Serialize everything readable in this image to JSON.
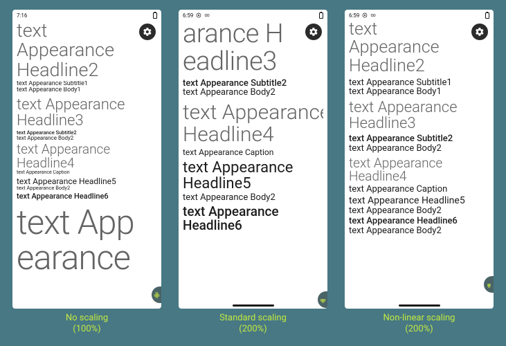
{
  "phones": [
    {
      "status_time": "7:16",
      "lines": {
        "l1": "text",
        "l2": "Appearance",
        "l3": "Headline2",
        "sub1": "text Appearance Subtitle1",
        "body1": "text Appearance Body1",
        "h3a": "text Appearance",
        "h3b": "Headline3",
        "sub2": "text Appearance Subtitle2",
        "body2": "text Appearance Body2",
        "h4a": "text Appearance",
        "h4b": "Headline4",
        "cap": "text Appearance Caption",
        "h5": "text Appearance Headline5",
        "bd2b": "text Appearance Body2",
        "h6": "text Appearance Headline6",
        "big1": "text App",
        "big2": "earance"
      }
    },
    {
      "status_time": "6:59",
      "lines": {
        "h3a": "arance H",
        "h3b": "eadline3",
        "sub2": "text Appearance Subtitle2",
        "body2": "text Appearance Body2",
        "h4a": "text Appearance",
        "h4b": "Headline4",
        "cap": "text Appearance Caption",
        "h5a": "text Appearance",
        "h5b": "Headline5",
        "bd2b": "text Appearance Body2",
        "h6a": "text Appearance",
        "h6b": "Headline6"
      }
    },
    {
      "status_time": "6:59",
      "lines": {
        "l1": "text",
        "l2": "Appearance",
        "l3": "Headline2",
        "sub1": "text Appearance Subtitle1",
        "body1": "text Appearance Body1",
        "h3a": "text Appearance",
        "h3b": "Headline3",
        "sub2": "text Appearance Subtitle2",
        "body2": "text Appearance Body2",
        "h4a": "text Appearance",
        "h4b": "Headline4",
        "cap": "text Appearance Caption",
        "h5": "text Appearance Headline5",
        "bd2b": "text Appearance Body2",
        "h6": "text Appearance Headline6",
        "bd2c": "text Appearance Body2"
      }
    }
  ],
  "captions": [
    {
      "title": "No scaling",
      "percent": "(100%)"
    },
    {
      "title": "Standard scaling",
      "percent": "(200%)"
    },
    {
      "title": "Non-linear scaling",
      "percent": "(200%)"
    }
  ]
}
